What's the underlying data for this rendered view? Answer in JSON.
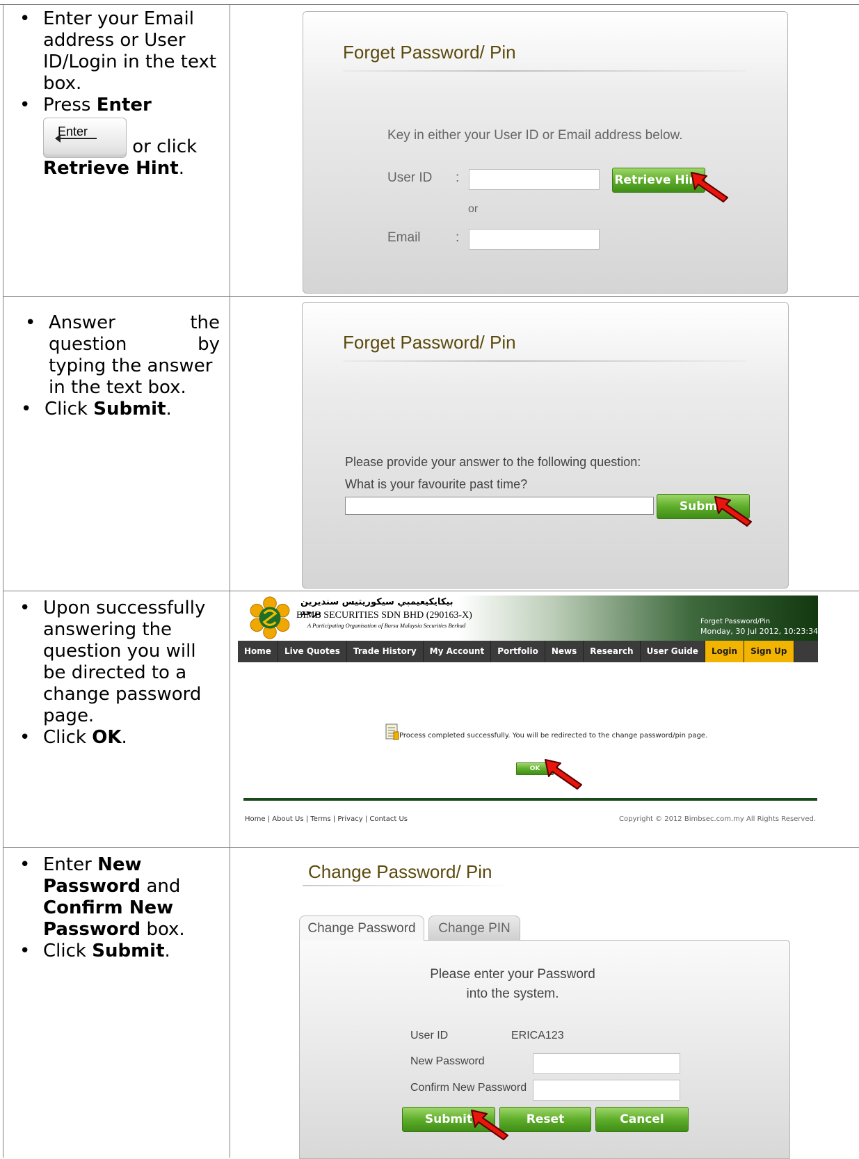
{
  "row1": {
    "instructions": {
      "b1": "Enter your Email address or User ID/Login in the text box.",
      "b2_pre": "Press",
      "b2_bold": "Enter",
      "enter_key_label": "Enter",
      "b2_mid": "or click",
      "b2_bold2": "Retrieve Hint",
      "b2_end": "."
    },
    "form": {
      "title": "Forget Password/ Pin",
      "prompt": "Key in either your User ID or Email address below.",
      "userid_label": "User ID",
      "colon": ":",
      "or_label": "or",
      "email_label": "Email",
      "retrieve_button": "Retrieve Hint"
    }
  },
  "row2": {
    "instructions": {
      "b1_words": [
        "Answer",
        "the",
        "question",
        "by"
      ],
      "b1_rest": "typing the answer in the text box.",
      "b2_pre": "Click",
      "b2_bold": "Submit",
      "b2_end": "."
    },
    "form": {
      "title": "Forget Password/ Pin",
      "prompt": "Please provide your answer to the following question:",
      "question": "What is your favourite past time?",
      "submit_button": "Submit"
    }
  },
  "row3": {
    "instructions": {
      "b1": "Upon successfully answering the question you will be directed to a change password page.",
      "b2_pre": "Click",
      "b2_bold": "OK",
      "b2_end": "."
    },
    "site": {
      "arabic_name": "بيكايكيعيمبي سيكوريتيس سنديرين برحد",
      "company": "BIMB SECURITIES SDN BHD (290163-X)",
      "tagline": "A Participating Organisation of Bursa Malaysia Securities Berhad",
      "page_name": "Forget Password/Pin",
      "datetime": "Monday, 30 Jul 2012, 10:23:34",
      "nav": [
        "Home",
        "Live Quotes",
        "Trade History",
        "My Account",
        "Portfolio",
        "News",
        "Research",
        "User Guide",
        "Login",
        "Sign Up"
      ],
      "message": "Process completed successfully. You will be redirected to the change password/pin page.",
      "ok_button": "OK",
      "footer_links": "Home | About Us | Terms | Privacy | Contact Us",
      "copyright": "Copyright © 2012 Bimbsec.com.my All Rights Reserved."
    }
  },
  "row4": {
    "instructions": {
      "b1_pre": "Enter",
      "b1_bold1": "New Password",
      "b1_mid": "and",
      "b1_bold2": "Confirm New Password",
      "b1_end": "box.",
      "b2_pre": "Click",
      "b2_bold": "Submit",
      "b2_end": "."
    },
    "form": {
      "title": "Change Password/ Pin",
      "tab_active": "Change Password",
      "tab_inactive": "Change PIN",
      "prompt_line1": "Please enter your Password",
      "prompt_line2": "into the system.",
      "userid_label": "User ID",
      "userid_value": "ERICA123",
      "new_password_label": "New Password",
      "confirm_label": "Confirm New Password",
      "submit_button": "Submit",
      "reset_button": "Reset",
      "cancel_button": "Cancel"
    }
  }
}
